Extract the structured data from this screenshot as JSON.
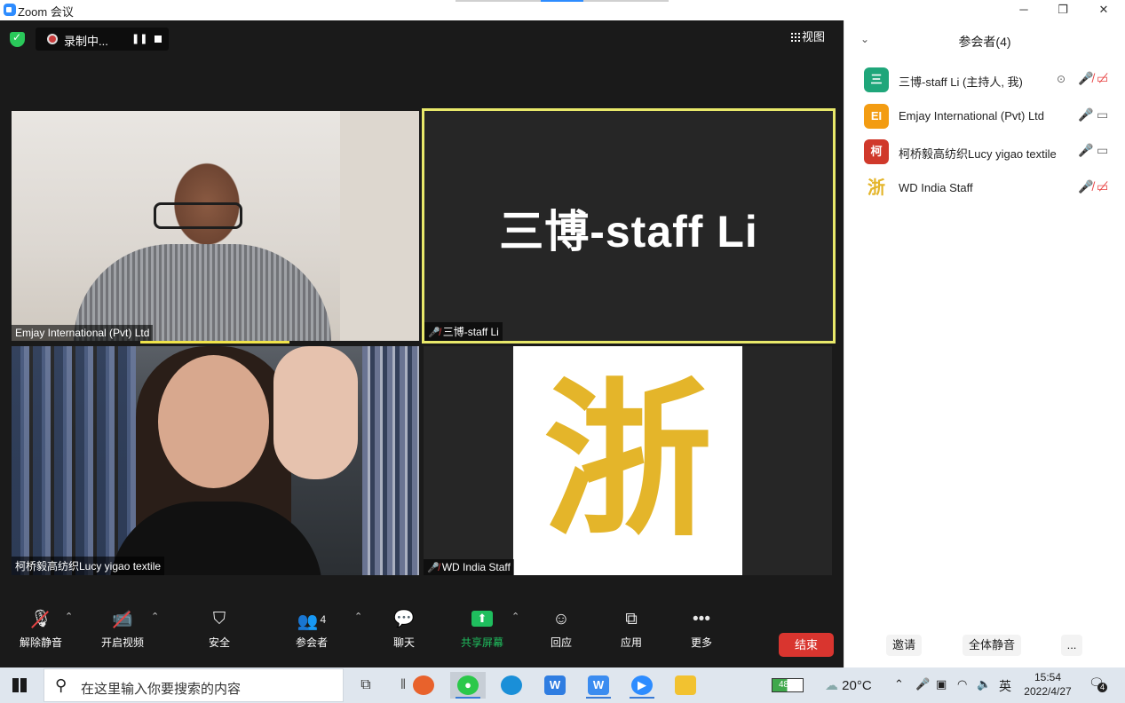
{
  "window": {
    "title": "Zoom 会议",
    "minimize": "─",
    "restore": "❐",
    "close": "✕"
  },
  "meeting": {
    "recording_label": "录制中...",
    "view_label": "视图",
    "tiles": [
      {
        "name": "Emjay International (Pvt) Ltd",
        "muted": false
      },
      {
        "name": "三博-staff Li",
        "display_text": "三博-staff Li",
        "muted": true
      },
      {
        "name": "柯桥毅高纺织Lucy yigao textile",
        "muted": false
      },
      {
        "name": "WD India Staff",
        "logo_text": "浙",
        "muted": true
      }
    ]
  },
  "toolbar": {
    "unmute": "解除静音",
    "start_video": "开启视频",
    "security": "安全",
    "participants": "参会者",
    "participants_count": "4",
    "chat": "聊天",
    "share_screen": "共享屏幕",
    "reactions": "回应",
    "apps": "应用",
    "more": "更多",
    "end": "结束"
  },
  "panel": {
    "title": "参会者(4)",
    "participants": [
      {
        "name": "三博-staff Li (主持人, 我)",
        "initials": "三",
        "color": "#1fa67a",
        "muted": true,
        "video_off": true
      },
      {
        "name": "Emjay International (Pvt) Ltd",
        "initials": "EI",
        "color": "#f39c12",
        "muted": false,
        "video_off": false
      },
      {
        "name": "柯桥毅高纺织Lucy yigao textile",
        "initials": "柯",
        "color": "#d0392b",
        "muted": false,
        "video_off": false
      },
      {
        "name": "WD India Staff",
        "initials": "浙",
        "color": "#e4b52a",
        "muted": true,
        "video_off": true
      }
    ],
    "invite": "邀请",
    "mute_all": "全体静音",
    "more": "..."
  },
  "taskbar": {
    "search_placeholder": "在这里输入你要搜索的内容",
    "battery": "48%",
    "temperature": "20°C",
    "ime": "英",
    "time": "15:54",
    "date": "2022/4/27",
    "notifications": "4"
  }
}
